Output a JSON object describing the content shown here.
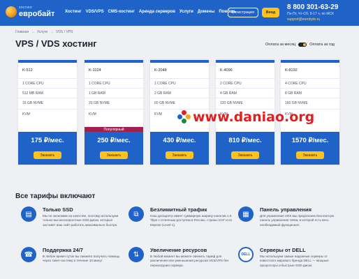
{
  "header": {
    "logo_small": "хостинг",
    "logo_big": "евробайт",
    "nav": [
      "Хостинг",
      "VDS/VPS",
      "CMS-хостинг",
      "Аренда серверов",
      "Услуги",
      "Домены",
      "Помощь"
    ],
    "register_label": "Регистрация",
    "login_label": "Вход",
    "phone": "8 800 301-63-29",
    "hours": "Пн-Пт, Чт-Сб, 9-17 ч. по МСК",
    "email": "support@eurobyte.ru"
  },
  "breadcrumb": [
    "Главная",
    "→",
    "Услуги",
    "→",
    "VDS / VPS"
  ],
  "page_title": "VPS / VDS хостинг",
  "billing": {
    "monthly": "Оплата за месяц",
    "yearly": "Оплата за год"
  },
  "plans": [
    {
      "name": "K-512",
      "specs": [
        "1 CORE CPU",
        "512 MB RAM",
        "15 GB NVME",
        "KVM"
      ],
      "price": "175 ₽/мес.",
      "order": "Заказать"
    },
    {
      "name": "K-1024",
      "specs": [
        "1 CORE CPU",
        "1 GB RAM",
        "20 GB NVME",
        "KVM"
      ],
      "price": "250 ₽/мес.",
      "order": "Заказать",
      "badge": "Популярный"
    },
    {
      "name": "K-2048",
      "specs": [
        "1 CORE CPU",
        "2 GB RAM",
        "60 GB NVME",
        "KVM"
      ],
      "price": "430 ₽/мес.",
      "order": "Заказать"
    },
    {
      "name": "K-4096",
      "specs": [
        "2 CORE CPU",
        "4 GB RAM",
        "120 GB NVME",
        "KVM"
      ],
      "price": "810 ₽/мес.",
      "order": "Заказать"
    },
    {
      "name": "K-8192",
      "specs": [
        "4 CORE CPU",
        "8 GB RAM",
        "160 GB NVME",
        "KVM"
      ],
      "price": "1570 ₽/мес.",
      "order": "Заказать"
    }
  ],
  "watermark": "www.daniao.org",
  "included_title": "Все тарифы включают",
  "features": [
    {
      "icon": "ssd-icon",
      "glyph": "▤",
      "title": "Только SSD",
      "desc": "Мы не экономим на качестве, поэтому используем только высокоскоростные SSD-диски, которые заставят ваш сайт работать максимально быстро."
    },
    {
      "icon": "network-icon",
      "glyph": "⧉",
      "title": "Безлимитный трафик",
      "desc": "Наш датацентр имеет суммарную ширину каналов 1.5 Tbps с отличным доступом в Россию, страны СНГ и по Европе (Level-1)."
    },
    {
      "icon": "panel-icon",
      "glyph": "▦",
      "title": "Панель управления",
      "desc": "Для управления VDS мы предлагаем бесплатную панель управления Vesta, в которой есть весь необходимый функционал."
    },
    {
      "icon": "support-icon",
      "glyph": "☎",
      "title": "Поддержка 24/7",
      "desc": "В любое время суток вы сможете получить помощь через тикет-систему в течение 10 минут."
    },
    {
      "icon": "resources-icon",
      "glyph": "⇅",
      "title": "Увеличение ресурсов",
      "desc": "В любой момент вы можете сменить тариф для увеличения или уменьшения ресурсов VDS/VPS без перезагрузки сервера."
    },
    {
      "icon": "dell-icon",
      "glyph": "DELL",
      "title": "Серверы от DELL",
      "desc": "Мы используем самые надежные серверы от известного мирового бренда DELL — мощные процессоры и быстрые SSD-диски."
    }
  ]
}
